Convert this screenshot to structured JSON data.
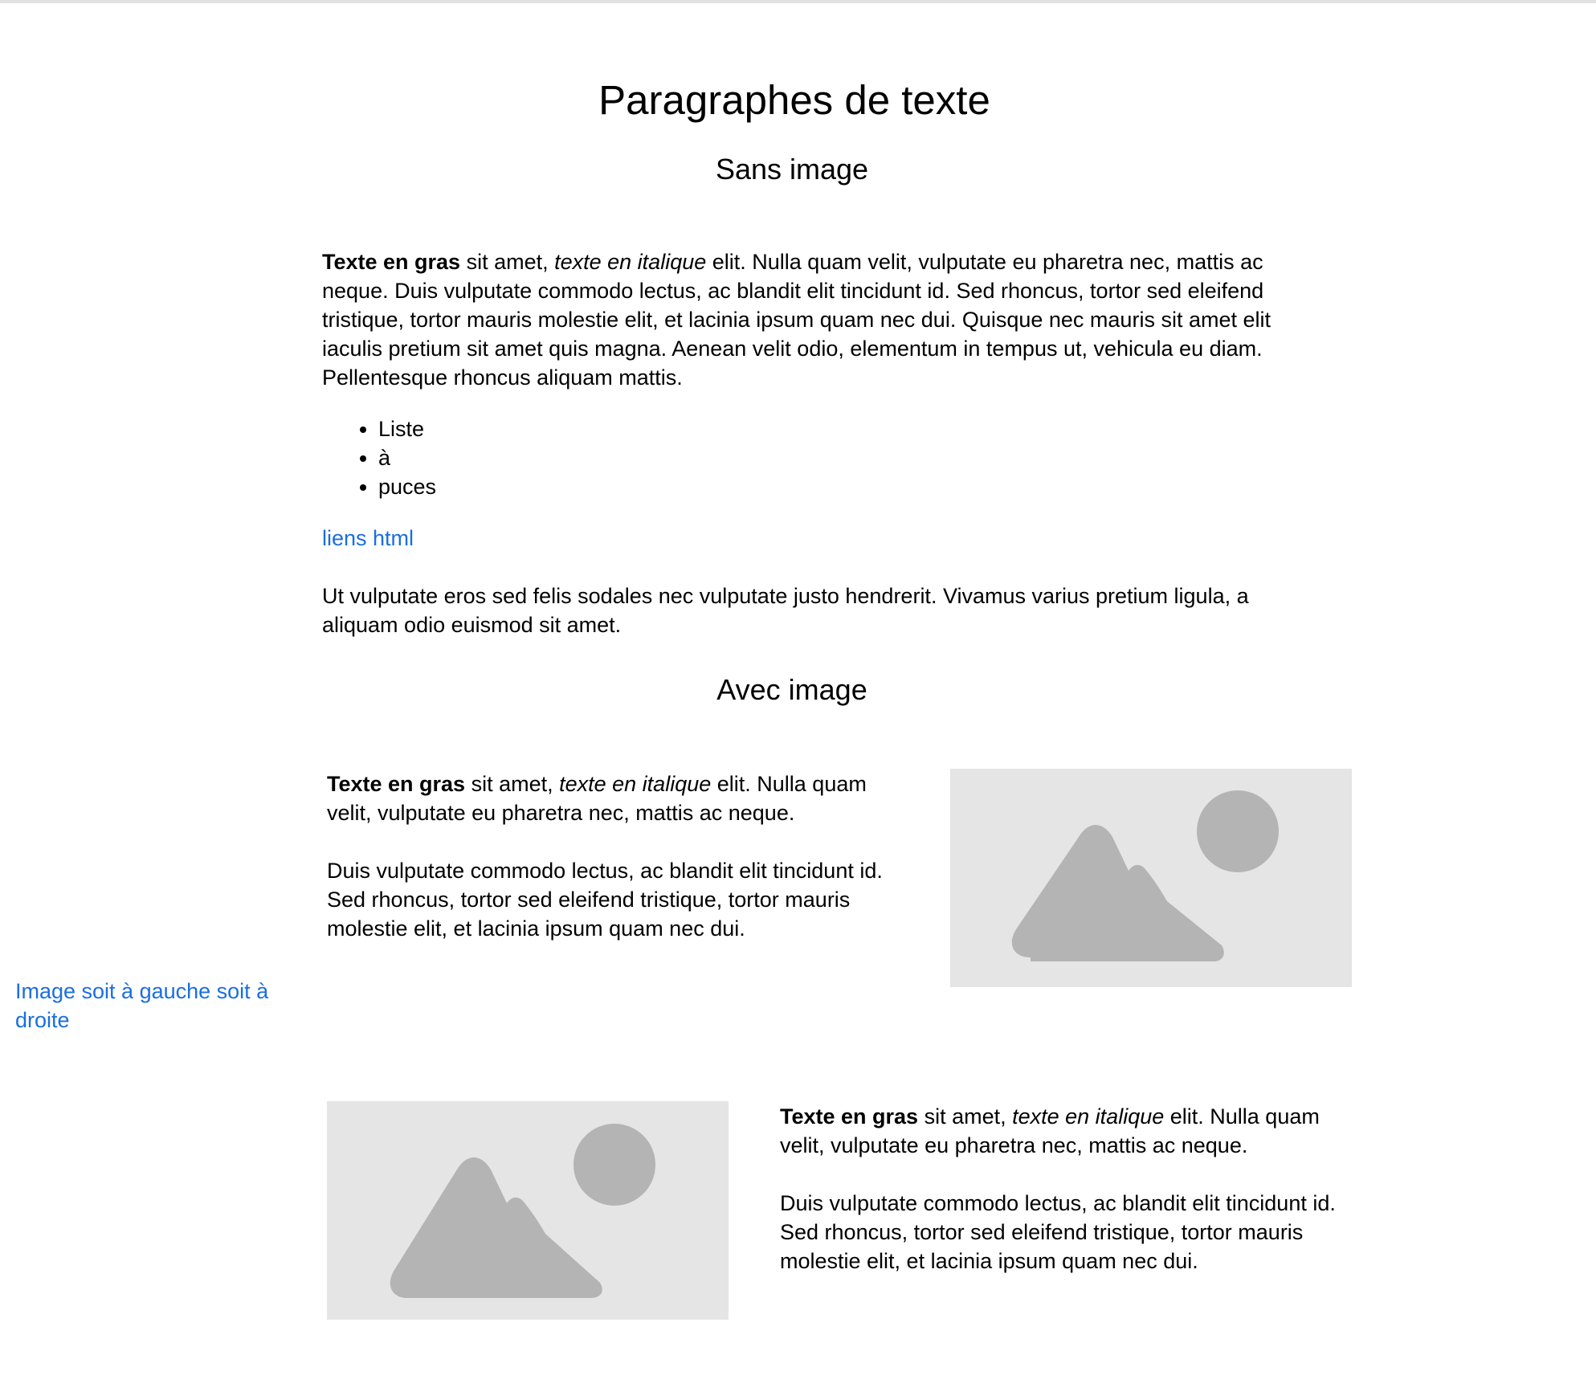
{
  "page_title": "Paragraphes de texte",
  "section_no_image": {
    "title": "Sans image",
    "paragraph1": {
      "bold": "Texte en gras",
      "after_bold": " sit amet, ",
      "italic": "texte en italique",
      "rest": " elit. Nulla quam velit, vulputate eu pharetra nec, mattis ac neque. Duis vulputate commodo lectus, ac blandit elit tincidunt id. Sed rhoncus, tortor sed eleifend tristique, tortor mauris molestie elit, et lacinia ipsum quam nec dui. Quisque nec mauris sit amet elit iaculis pretium sit amet quis magna. Aenean velit odio, elementum in tempus ut, vehicula eu diam. Pellentesque rhoncus aliquam mattis."
    },
    "bullets": [
      "Liste",
      "à",
      "puces"
    ],
    "link_label": "liens html",
    "paragraph2": "Ut vulputate eros sed felis sodales nec vulputate justo hendrerit. Vivamus varius pretium ligula, a aliquam odio euismod sit amet."
  },
  "section_with_image": {
    "title": "Avec image",
    "side_link_label": "Image soit à gauche soit à droite",
    "block1": {
      "bold": "Texte en gras",
      "after_bold": " sit amet, ",
      "italic": "texte en italique",
      "rest": " elit. Nulla quam velit, vulputate eu pharetra nec, mattis ac neque.",
      "paragraph2": "Duis vulputate commodo lectus, ac blandit elit tincidunt id. Sed rhoncus, tortor sed eleifend tristique, tortor mauris molestie elit, et lacinia ipsum quam nec dui."
    },
    "block2": {
      "bold": "Texte en gras",
      "after_bold": " sit amet, ",
      "italic": "texte en italique",
      "rest": " elit. Nulla quam velit, vulputate eu pharetra nec, mattis ac neque.",
      "paragraph2": "Duis vulputate commodo lectus, ac blandit elit tincidunt id. Sed rhoncus, tortor sed eleifend tristique, tortor mauris molestie elit, et lacinia ipsum quam nec dui."
    }
  },
  "colors": {
    "link": "#1a6ee0",
    "placeholder_bg": "#e5e5e5",
    "placeholder_shape": "#b4b4b4"
  }
}
